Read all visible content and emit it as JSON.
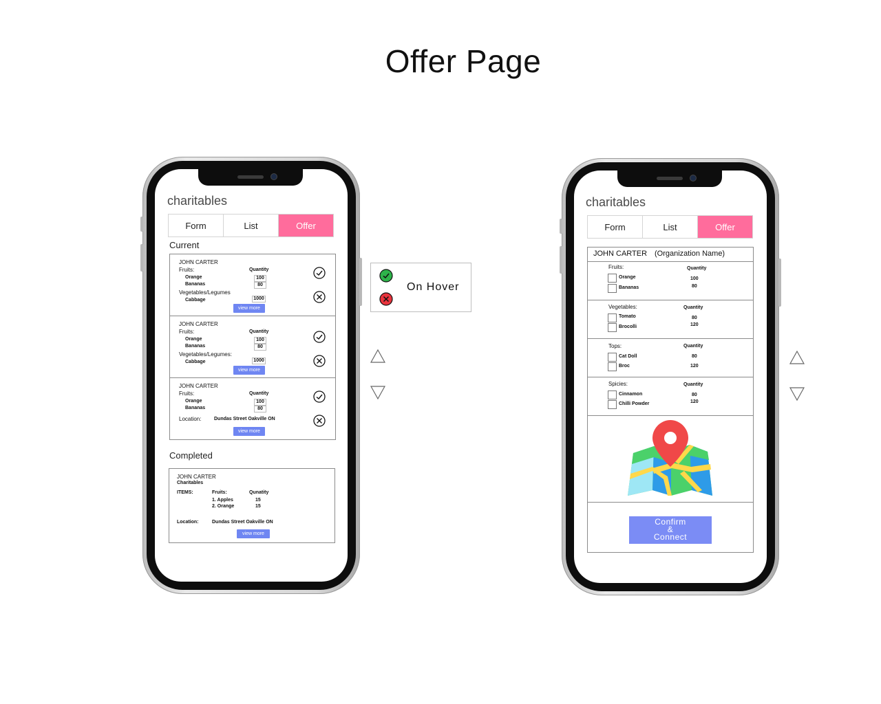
{
  "page_title": "Offer Page",
  "brand": "charitables",
  "tabs": [
    "Form",
    "List",
    "Offer"
  ],
  "left_phone": {
    "current_label": "Current",
    "completed_label": "Completed",
    "cards": [
      {
        "name": "JOHN CARTER",
        "fruits_label": "Fruits:",
        "quantity_label": "Quantity",
        "items": [
          {
            "name": "Orange",
            "qty": "100"
          },
          {
            "name": "Bananas",
            "qty": "80"
          }
        ],
        "veg_label": "Vegetables/Legumes",
        "veg_items": [
          {
            "name": "Cabbage",
            "qty": "1000"
          }
        ],
        "button": "view more"
      },
      {
        "name": "JOHN CARTER",
        "fruits_label": "Fruits:",
        "quantity_label": "Quantity",
        "items": [
          {
            "name": "Orange",
            "qty": "100"
          },
          {
            "name": "Bananas",
            "qty": "80"
          }
        ],
        "veg_label": "Vegetables/Legumes:",
        "veg_items": [
          {
            "name": "Cabbage",
            "qty": "1000"
          }
        ],
        "button": "view more"
      },
      {
        "name": "JOHN CARTER",
        "fruits_label": "Fruits:",
        "quantity_label": "Quantity",
        "items": [
          {
            "name": "Orange",
            "qty": "100"
          },
          {
            "name": "Bananas",
            "qty": "80"
          }
        ],
        "location_label": "Location:",
        "location": "Dundas Street Oakville ON",
        "button": "view more"
      }
    ],
    "completed_card": {
      "name": "JOHN CARTER",
      "org": "Charitables",
      "items_label": "ITEMS:",
      "fruits_label": "Fruits:",
      "quantity_label": "Qunatity",
      "items": [
        {
          "name": "1. Apples",
          "qty": "15"
        },
        {
          "name": "2. Orange",
          "qty": "15"
        }
      ],
      "location_label": "Location:",
      "location": "Dundas Street Oakville ON",
      "button": "view more"
    }
  },
  "hover_panel": {
    "label": "On Hover",
    "accept_color": "#2eb34a",
    "reject_color": "#e8343d"
  },
  "right_phone": {
    "header_name": "JOHN CARTER",
    "header_org": "(Organization Name)",
    "groups": [
      {
        "label": "Fruits:",
        "quantity_label": "Quantity",
        "items": [
          {
            "name": "Orange",
            "qty": "100"
          },
          {
            "name": "Bananas",
            "qty": "80"
          }
        ]
      },
      {
        "label": "Vegetables:",
        "quantity_label": "Quantity",
        "items": [
          {
            "name": "Tomato",
            "qty": "80"
          },
          {
            "name": "Brocolli",
            "qty": "120"
          }
        ]
      },
      {
        "label": "Tops:",
        "quantity_label": "Quantity",
        "items": [
          {
            "name": "Cat Doll",
            "qty": "80"
          },
          {
            "name": "Broc",
            "qty": "120"
          }
        ]
      },
      {
        "label": "Spicies:",
        "quantity_label": "Quantity",
        "items": [
          {
            "name": "Cinnamon",
            "qty": "80"
          },
          {
            "name": "Chilli Powder",
            "qty": "120"
          }
        ]
      }
    ],
    "confirm": {
      "line1": "Confirm",
      "line2": "&",
      "line3": "Connect"
    }
  },
  "colors": {
    "accent_pink": "#ff6c9c",
    "button_blue": "#6f86f2",
    "confirm_blue": "#7b8cf5"
  }
}
